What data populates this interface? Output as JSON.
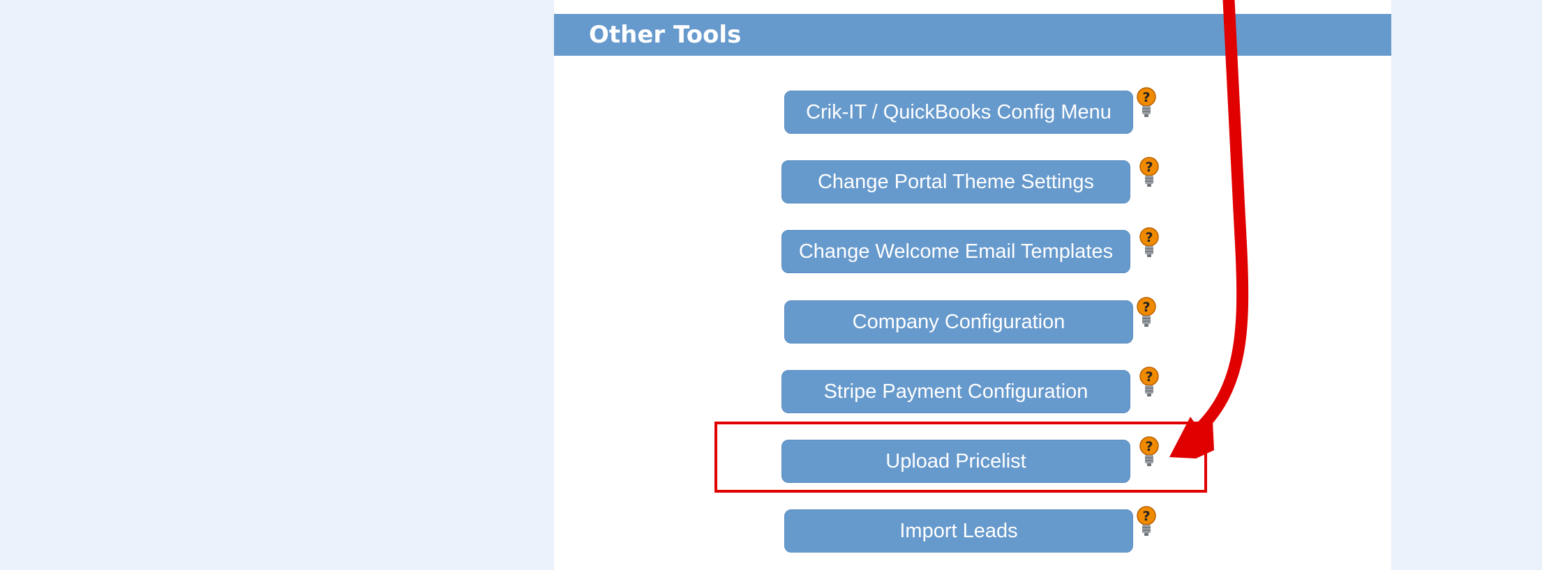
{
  "section": {
    "title": "Other Tools"
  },
  "tools": [
    {
      "label": "Crik-IT / QuickBooks Config Menu"
    },
    {
      "label": "Change Portal Theme Settings"
    },
    {
      "label": "Change Welcome Email Templates"
    },
    {
      "label": "Company Configuration"
    },
    {
      "label": "Stripe Payment Configuration"
    },
    {
      "label": "Upload Pricelist"
    },
    {
      "label": "Import Leads"
    }
  ],
  "icons": {
    "help": "lightbulb-question-icon"
  },
  "colors": {
    "page_background": "#eaf1fa",
    "panel_background": "#ffffff",
    "accent": "#6699cc",
    "button_text": "#ffffff",
    "help_icon": "#f08a00",
    "annotation": "#e00000"
  }
}
